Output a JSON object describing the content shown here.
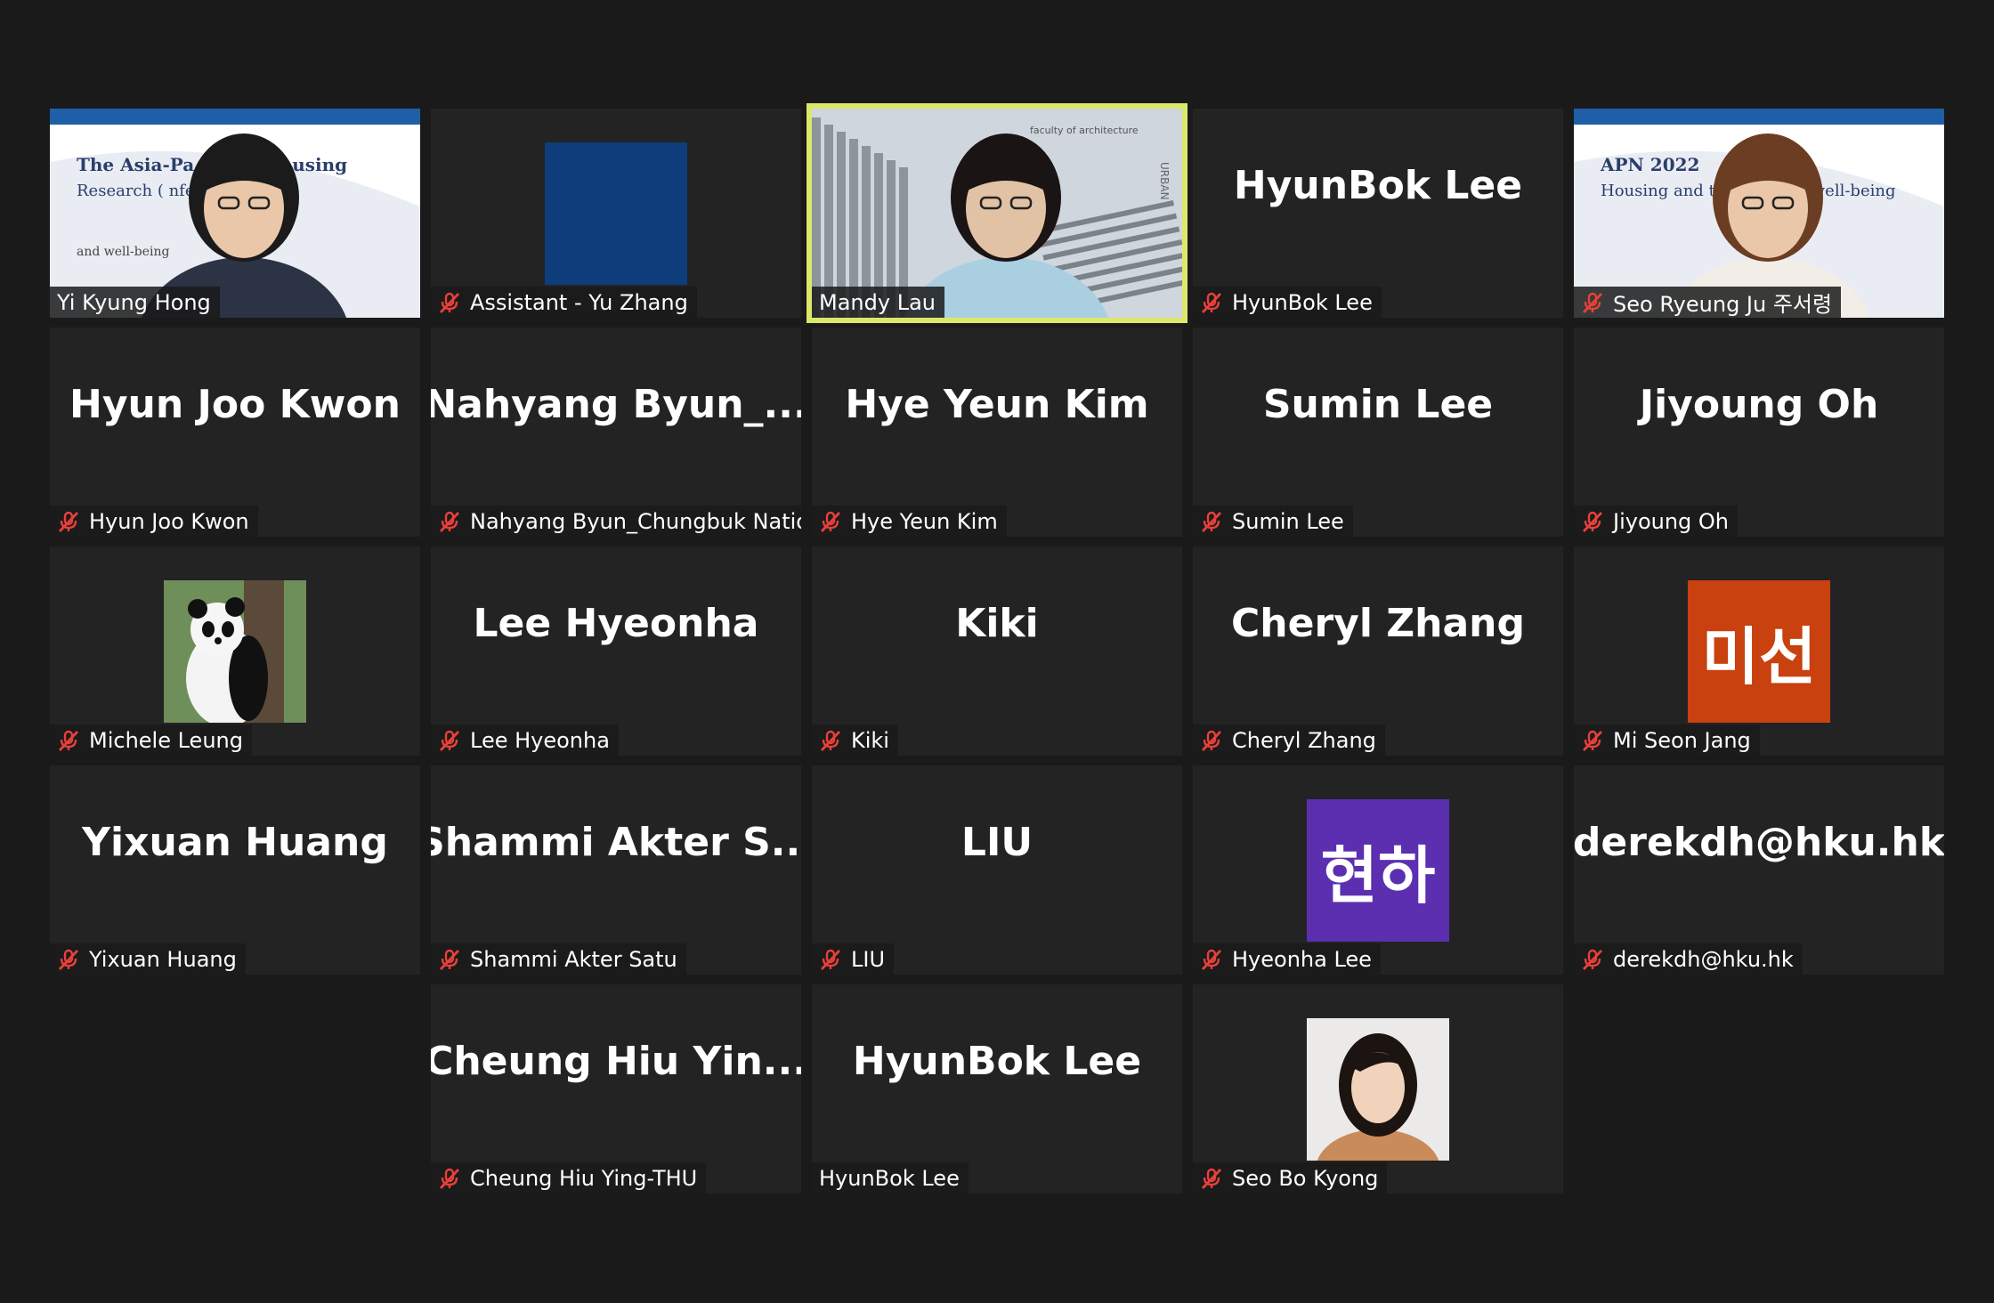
{
  "colors": {
    "background": "#1a1a1a",
    "tile": "#232323",
    "active_speaker_border": "#dbe86a",
    "mute_icon": "#e8403a",
    "avatar_orange": "#c8410e",
    "avatar_purple": "#5b2fb0"
  },
  "tiles": [
    {
      "label": "Yi Kyung Hong",
      "muted": false,
      "kind": "video",
      "banner_line1": "The Asia-Pa     rk for Housing",
      "banner_line2": "Research (      nference 2022",
      "banner_line3": "and well-being"
    },
    {
      "label": "Assistant - Yu Zhang",
      "muted": true,
      "kind": "video-blue"
    },
    {
      "label": "Mandy Lau",
      "muted": false,
      "kind": "video-active",
      "overlay_text": "faculty of architecture",
      "side_text": "URBAN"
    },
    {
      "label": "HyunBok Lee",
      "muted": true,
      "kind": "name",
      "big": "HyunBok Lee"
    },
    {
      "label": "Seo Ryeung Ju 주서령",
      "muted": true,
      "kind": "video",
      "banner_line1": "APN        2022",
      "banner_line2": "Housing and the       uity and well-being"
    },
    {
      "label": "Hyun Joo Kwon",
      "muted": true,
      "kind": "name",
      "big": "Hyun Joo Kwon"
    },
    {
      "label": "Nahyang Byun_Chungbuk Natio...",
      "muted": true,
      "kind": "name",
      "big": "Nahyang  Byun_..."
    },
    {
      "label": "Hye Yeun Kim",
      "muted": true,
      "kind": "name",
      "big": "Hye Yeun Kim"
    },
    {
      "label": "Sumin Lee",
      "muted": true,
      "kind": "name",
      "big": "Sumin Lee"
    },
    {
      "label": "Jiyoung Oh",
      "muted": true,
      "kind": "name",
      "big": "Jiyoung Oh"
    },
    {
      "label": "Michele Leung",
      "muted": true,
      "kind": "photo-panda"
    },
    {
      "label": "Lee Hyeonha",
      "muted": true,
      "kind": "name",
      "big": "Lee Hyeonha"
    },
    {
      "label": "Kiki",
      "muted": true,
      "kind": "name",
      "big": "Kiki"
    },
    {
      "label": "Cheryl Zhang",
      "muted": true,
      "kind": "name",
      "big": "Cheryl Zhang"
    },
    {
      "label": "Mi Seon Jang",
      "muted": true,
      "kind": "avatar-orange",
      "avatar_text": "미선"
    },
    {
      "label": "Yixuan Huang",
      "muted": true,
      "kind": "name",
      "big": "Yixuan Huang"
    },
    {
      "label": "Shammi Akter Satu",
      "muted": true,
      "kind": "name",
      "big": "Shammi  Akter  S..."
    },
    {
      "label": "LIU",
      "muted": true,
      "kind": "name",
      "big": "LIU"
    },
    {
      "label": "Hyeonha Lee",
      "muted": true,
      "kind": "avatar-purple",
      "avatar_text": "현하"
    },
    {
      "label": "derekdh@hku.hk",
      "muted": true,
      "kind": "name",
      "big": "derekdh@hku.hk"
    },
    {
      "label": "Cheung Hiu Ying-THU",
      "muted": true,
      "kind": "name",
      "big": "Cheung  Hiu  Yin..."
    },
    {
      "label": "HyunBok Lee",
      "muted": false,
      "kind": "name",
      "big": "HyunBok Lee"
    },
    {
      "label": "Seo Bo Kyong",
      "muted": true,
      "kind": "photo-portrait"
    }
  ]
}
